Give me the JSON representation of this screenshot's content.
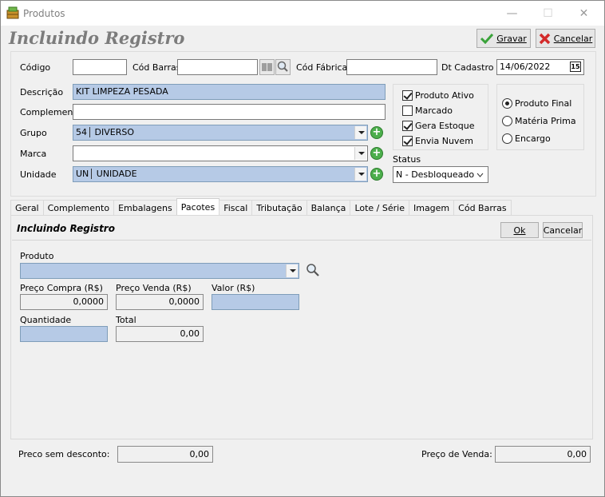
{
  "window": {
    "title": "Produtos",
    "minimize": "—",
    "maximize": "☐",
    "close": "✕"
  },
  "header": {
    "title": "Incluindo Registro",
    "save_label": "Gravar",
    "cancel_label": "Cancelar"
  },
  "form": {
    "codigo_label": "Código",
    "codigo_value": "",
    "cod_barras_label": "Cód Barras",
    "cod_barras_value": "",
    "cod_fabrica_label": "Cód Fábrica",
    "cod_fabrica_value": "",
    "dt_cadastro_label": "Dt Cadastro",
    "dt_cadastro_value": "14/06/2022",
    "calendar_glyph": "15",
    "descricao_label": "Descrição",
    "descricao_value": "KIT LIMPEZA PESADA",
    "complemento_label": "Complemento",
    "complemento_value": "",
    "grupo_label": "Grupo",
    "grupo_code": "54",
    "grupo_name": "DIVERSO",
    "marca_label": "Marca",
    "marca_value": "",
    "unidade_label": "Unidade",
    "unidade_code": "UN",
    "unidade_name": "UNIDADE"
  },
  "flags": [
    {
      "label": "Produto Ativo",
      "checked": true
    },
    {
      "label": "Marcado",
      "checked": false
    },
    {
      "label": "Gera Estoque",
      "checked": true
    },
    {
      "label": "Envia Nuvem",
      "checked": true
    }
  ],
  "status": {
    "label": "Status",
    "value": "N - Desbloqueado"
  },
  "tipo": [
    {
      "label": "Produto Final",
      "selected": true
    },
    {
      "label": "Matéria Prima",
      "selected": false
    },
    {
      "label": "Encargo",
      "selected": false
    }
  ],
  "tabs": [
    "Geral",
    "Complemento",
    "Embalagens",
    "Pacotes",
    "Fiscal",
    "Tributação",
    "Balança",
    "Lote / Série",
    "Imagem",
    "Cód Barras"
  ],
  "active_tab": "Pacotes",
  "pacotes": {
    "title": "Incluindo Registro",
    "ok_label": "Ok",
    "cancel_label": "Cancelar",
    "produto_label": "Produto",
    "produto_value": "",
    "preco_compra_label": "Preço Compra (R$)",
    "preco_compra_value": "0,0000",
    "preco_venda_label": "Preço Venda (R$)",
    "preco_venda_value": "0,0000",
    "valor_label": "Valor (R$)",
    "valor_value": "",
    "quantidade_label": "Quantidade",
    "quantidade_value": "",
    "total_label": "Total",
    "total_value": "0,00"
  },
  "footer": {
    "preco_sem_desconto_label": "Preco sem desconto:",
    "preco_sem_desconto_value": "0,00",
    "preco_venda_label": "Preço de Venda:",
    "preco_venda_value": "0,00"
  }
}
